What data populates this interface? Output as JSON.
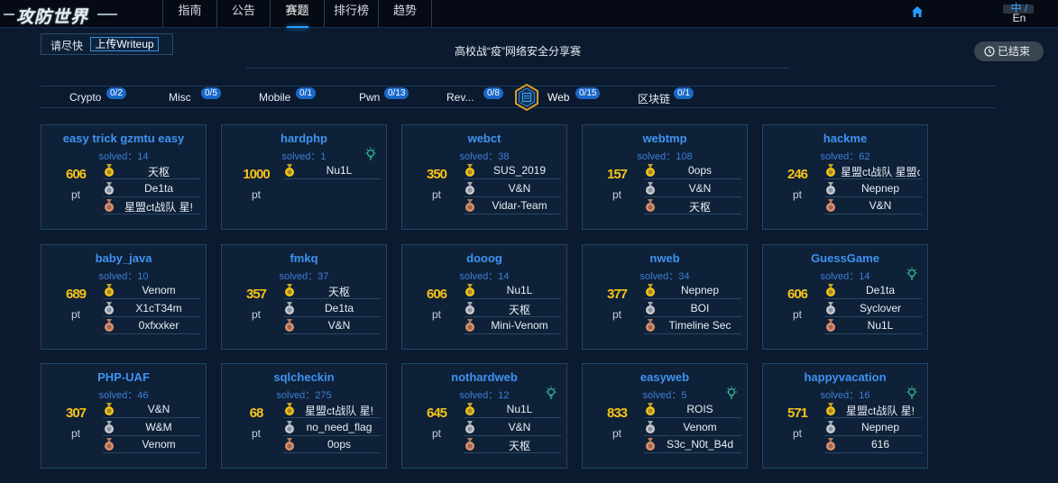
{
  "app": {
    "logo_text": "攻防世界"
  },
  "nav": [
    {
      "label": "指南",
      "active": false
    },
    {
      "label": "公告",
      "active": false
    },
    {
      "label": "赛题",
      "active": true
    },
    {
      "label": "排行榜",
      "active": false
    },
    {
      "label": "趋势",
      "active": false
    }
  ],
  "lang": {
    "zh": "中 /",
    "en": "En"
  },
  "header": {
    "notice": "请尽快",
    "upload_label": "上传Writeup",
    "title": "高校战“疫”网络安全分享赛",
    "status": "已结束"
  },
  "tabs": [
    {
      "name": "Crypto",
      "count": "0/2"
    },
    {
      "name": "Misc",
      "count": "0/5"
    },
    {
      "name": "Mobile",
      "count": "0/1"
    },
    {
      "name": "Pwn",
      "count": "0/13"
    },
    {
      "name": "Rev...",
      "count": "0/8"
    },
    {
      "name": "Web",
      "count": "0/15"
    },
    {
      "name": "区块链",
      "count": "0/1"
    }
  ],
  "challenges": [
    {
      "name": "easy   trick   gzmtu    easy",
      "solved": "solved：14",
      "points": "606",
      "unit": "pt",
      "hint": false,
      "top": [
        "天枢",
        "De1ta",
        "星盟ct战队    星!"
      ]
    },
    {
      "name": "hardphp",
      "solved": "solved：1",
      "points": "1000",
      "unit": "pt",
      "hint": true,
      "top": [
        "Nu1L"
      ]
    },
    {
      "name": "webct",
      "solved": "solved：38",
      "points": "350",
      "unit": "pt",
      "hint": false,
      "top": [
        "SUS_2019",
        "V&N",
        "Vidar-Team"
      ]
    },
    {
      "name": "webtmp",
      "solved": "solved：108",
      "points": "157",
      "unit": "pt",
      "hint": false,
      "top": [
        "0ops",
        "V&N",
        "天枢"
      ]
    },
    {
      "name": "hackme",
      "solved": "solved：62",
      "points": "246",
      "unit": "pt",
      "hint": false,
      "top": [
        "星盟ct战队    星盟ct",
        "Nepnep",
        "V&N"
      ]
    },
    {
      "name": "baby_java",
      "solved": "solved：10",
      "points": "689",
      "unit": "pt",
      "hint": false,
      "top": [
        "Venom",
        "X1cT34m",
        "0xfxxker"
      ]
    },
    {
      "name": "fmkq",
      "solved": "solved：37",
      "points": "357",
      "unit": "pt",
      "hint": false,
      "top": [
        "天枢",
        "De1ta",
        "V&N"
      ]
    },
    {
      "name": "dooog",
      "solved": "solved：14",
      "points": "606",
      "unit": "pt",
      "hint": false,
      "top": [
        "Nu1L",
        "天枢",
        "Mini-Venom"
      ]
    },
    {
      "name": "nweb",
      "solved": "solved：34",
      "points": "377",
      "unit": "pt",
      "hint": false,
      "top": [
        "Nepnep",
        "BOI",
        "Timeline Sec"
      ]
    },
    {
      "name": "GuessGame",
      "solved": "solved：14",
      "points": "606",
      "unit": "pt",
      "hint": true,
      "top": [
        "De1ta",
        "Syclover",
        "Nu1L"
      ]
    },
    {
      "name": "PHP-UAF",
      "solved": "solved：46",
      "points": "307",
      "unit": "pt",
      "hint": false,
      "top": [
        "V&N",
        "W&M",
        "Venom"
      ]
    },
    {
      "name": "sqlcheckin",
      "solved": "solved：275",
      "points": "68",
      "unit": "pt",
      "hint": false,
      "top": [
        "星盟ct战队    星!",
        "no_need_flag",
        "0ops"
      ]
    },
    {
      "name": "nothardweb",
      "solved": "solved：12",
      "points": "645",
      "unit": "pt",
      "hint": true,
      "top": [
        "Nu1L",
        "V&N",
        "天枢"
      ]
    },
    {
      "name": "easyweb",
      "solved": "solved：5",
      "points": "833",
      "unit": "pt",
      "hint": true,
      "top": [
        "ROIS",
        "Venom",
        "S3c_N0t_B4d"
      ]
    },
    {
      "name": "happyvacation",
      "solved": "solved：16",
      "points": "571",
      "unit": "pt",
      "hint": true,
      "top": [
        "星盟ct战队    星!",
        "Nepnep",
        "616"
      ]
    }
  ],
  "colors": {
    "gold": "#f5c318",
    "silver": "#c8ccd2",
    "bronze": "#e0906a",
    "title_blue": "#3f93f2",
    "hint_green": "#35c49a",
    "badge_blue": "#1a68c8"
  }
}
